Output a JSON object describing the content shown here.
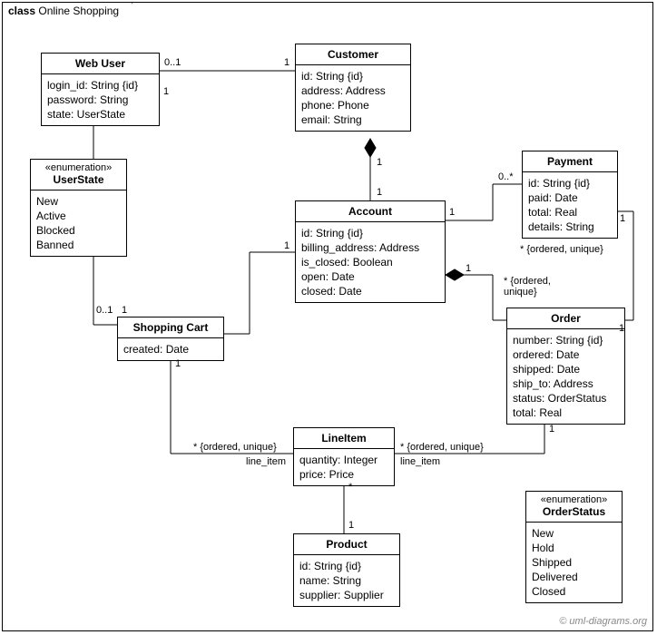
{
  "frame": {
    "kind": "class",
    "title": "Online Shopping"
  },
  "classes": {
    "webUser": {
      "name": "Web User",
      "attrs": [
        "login_id: String {id}",
        "password: String",
        "state: UserState"
      ]
    },
    "userState": {
      "stereotype": "«enumeration»",
      "name": "UserState",
      "attrs": [
        "New",
        "Active",
        "Blocked",
        "Banned"
      ]
    },
    "customer": {
      "name": "Customer",
      "attrs": [
        "id: String {id}",
        "address: Address",
        "phone: Phone",
        "email: String"
      ]
    },
    "account": {
      "name": "Account",
      "attrs": [
        "id: String {id}",
        "billing_address: Address",
        "is_closed: Boolean",
        "open: Date",
        "closed: Date"
      ]
    },
    "payment": {
      "name": "Payment",
      "attrs": [
        "id: String {id}",
        "paid: Date",
        "total: Real",
        "details: String"
      ]
    },
    "order": {
      "name": "Order",
      "attrs": [
        "number: String {id}",
        "ordered: Date",
        "shipped: Date",
        "ship_to: Address",
        "status: OrderStatus",
        "total: Real"
      ]
    },
    "shoppingCart": {
      "name": "Shopping Cart",
      "attrs": [
        "created: Date"
      ]
    },
    "lineItem": {
      "name": "LineItem",
      "attrs": [
        "quantity: Integer",
        "price: Price"
      ]
    },
    "product": {
      "name": "Product",
      "attrs": [
        "id: String {id}",
        "name: String",
        "supplier: Supplier"
      ]
    },
    "orderStatus": {
      "stereotype": "«enumeration»",
      "name": "OrderStatus",
      "attrs": [
        "New",
        "Hold",
        "Shipped",
        "Delivered",
        "Closed"
      ]
    }
  },
  "labels": {
    "webUser_customer_left": "0..1",
    "webUser_customer_right": "1",
    "customer_account_top": "1",
    "customer_account_bottom": "1",
    "account_payment_left": "1",
    "account_payment_right": "0..*",
    "account_payment_constraint": "* {ordered, unique}",
    "account_order_left": "1",
    "account_order_constraint": "* {ordered,\nunique}",
    "webUser_cart_top": "1",
    "webUser_cart_left": "0..1",
    "cart_account_left": "1",
    "cart_account_right": "1",
    "cart_line_left": "1",
    "cart_line_constraint": "* {ordered, unique}",
    "cart_line_role": "line_item",
    "order_line_right": "1",
    "order_line_constraint": "* {ordered, unique}",
    "order_line_role": "line_item",
    "order_payment_bottom": "1",
    "order_payment_top": "1",
    "line_product_top": "*",
    "line_product_bottom": "1"
  },
  "credit": "© uml-diagrams.org"
}
